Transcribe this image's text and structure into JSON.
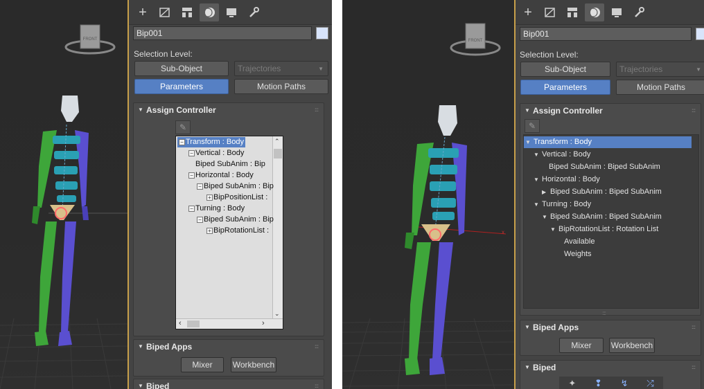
{
  "left": {
    "viewcube": {
      "label": "FRONT"
    },
    "panel": {
      "name_value": "Bip001",
      "selection_level_label": "Selection Level:",
      "subobject_label": "Sub-Object",
      "trajectories_label": "Trajectories",
      "parameters_label": "Parameters",
      "motion_paths_label": "Motion Paths",
      "assign_controller_title": "Assign Controller",
      "tree": [
        {
          "label": "Transform : Body",
          "toggle": "−",
          "selected": true
        },
        {
          "label": "Vertical : Body",
          "toggle": "−"
        },
        {
          "label": "Biped SubAnim : Bip",
          "toggle": ""
        },
        {
          "label": "Horizontal : Body",
          "toggle": "−"
        },
        {
          "label": "Biped SubAnim : Bip",
          "toggle": "−"
        },
        {
          "label": "BipPositionList :",
          "toggle": "+"
        },
        {
          "label": "Turning : Body",
          "toggle": "−"
        },
        {
          "label": "Biped SubAnim : Bip",
          "toggle": "−"
        },
        {
          "label": "BipRotationList :",
          "toggle": "+"
        }
      ],
      "biped_apps_title": "Biped Apps",
      "mixer_label": "Mixer",
      "workbench_label": "Workbench",
      "biped_title": "Biped"
    }
  },
  "right": {
    "viewcube": {
      "label": "FRONT"
    },
    "panel": {
      "name_value": "Bip001",
      "selection_level_label": "Selection Level:",
      "subobject_label": "Sub-Object",
      "trajectories_label": "Trajectories",
      "parameters_label": "Parameters",
      "motion_paths_label": "Motion Paths",
      "assign_controller_title": "Assign Controller",
      "tree": [
        {
          "label": "Transform : Body",
          "arrow": "down",
          "selected": true
        },
        {
          "label": "Vertical : Body",
          "arrow": "down"
        },
        {
          "label": "Biped SubAnim : Biped SubAnim",
          "arrow": ""
        },
        {
          "label": "Horizontal : Body",
          "arrow": "down"
        },
        {
          "label": "Biped SubAnim : Biped SubAnim",
          "arrow": "right"
        },
        {
          "label": "Turning : Body",
          "arrow": "down"
        },
        {
          "label": "Biped SubAnim : Biped SubAnim",
          "arrow": "down"
        },
        {
          "label": "BipRotationList : Rotation List",
          "arrow": "down"
        },
        {
          "label": "Available",
          "arrow": ""
        },
        {
          "label": "Weights",
          "arrow": ""
        }
      ],
      "biped_apps_title": "Biped Apps",
      "mixer_label": "Mixer",
      "workbench_label": "Workbench",
      "biped_title": "Biped"
    }
  },
  "icons": {
    "tabs": [
      "create-icon",
      "modify-icon",
      "hierarchy-icon",
      "motion-icon",
      "display-icon",
      "utilities-icon"
    ],
    "biped_tools": [
      "figure-mode-icon",
      "footstep-mode-icon",
      "motion-flow-icon",
      "mixer-mode-icon"
    ]
  },
  "colors": {
    "accent": "#5680c4",
    "viewport_border": "#c8a04a",
    "biped_left": "#3ea63a",
    "biped_right": "#5a4fd0",
    "spine": "#2aa0b4"
  }
}
